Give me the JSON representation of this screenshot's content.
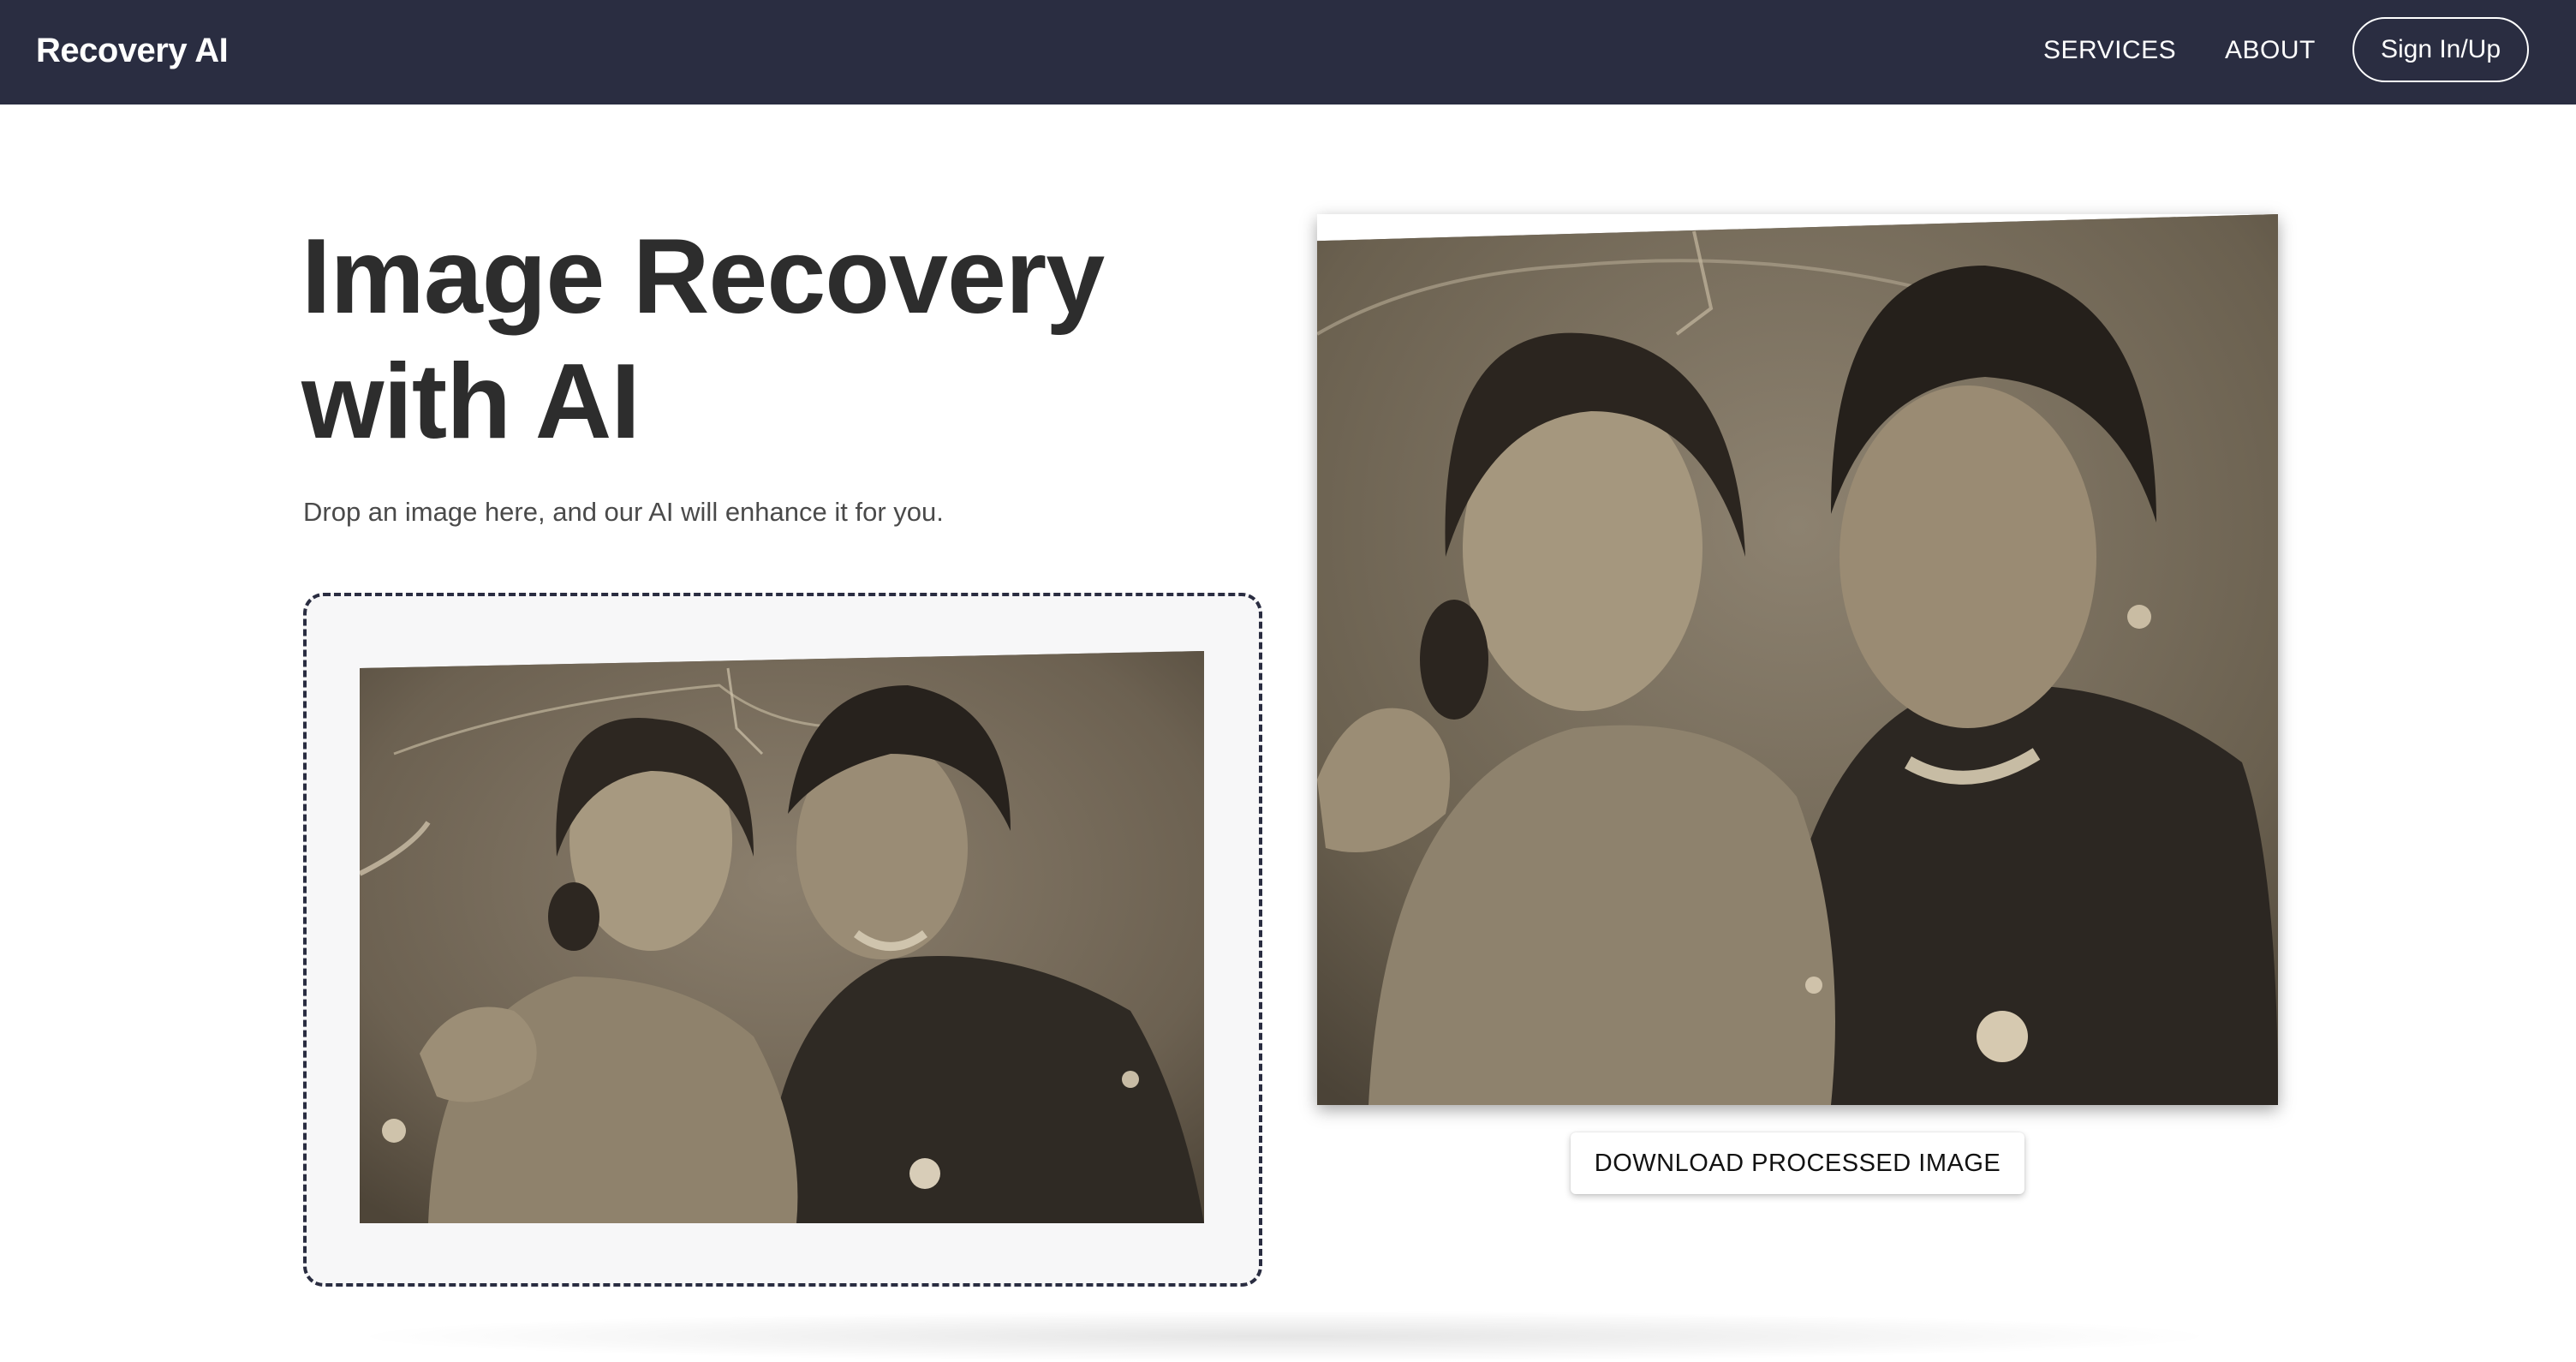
{
  "navbar": {
    "brand": "Recovery AI",
    "links": [
      "SERVICES",
      "ABOUT"
    ],
    "signin_label": "Sign In/Up"
  },
  "hero": {
    "title": "Image Recovery with AI",
    "subtitle": "Drop an image here, and our AI will enhance it for you."
  },
  "download": {
    "label": "DOWNLOAD PROCESSED IMAGE"
  },
  "colors": {
    "navbar_bg": "#2a2d41",
    "title_text": "#2d2d2d",
    "dropzone_border": "#2a2d41",
    "photo_sepia": "#6f6557"
  },
  "images": {
    "original": "old damaged sepia photo of a couple",
    "processed": "restored sepia photo of a couple"
  }
}
